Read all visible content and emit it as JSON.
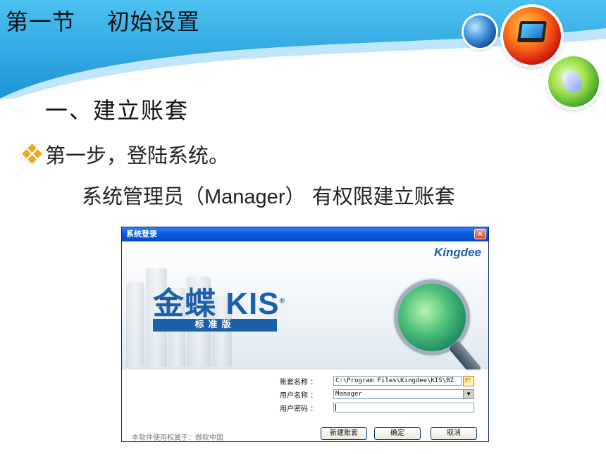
{
  "slide": {
    "title": "第一节    初始设置",
    "heading": "一、建立账套",
    "bullet": "第一步，登陆系统。",
    "line_pre": "系统管理员（",
    "line_latin": "Manager",
    "line_post": "） 有权限建立账套",
    "accent_colors": {
      "header": "#29a3e0",
      "bullet": "#f2a81c"
    }
  },
  "dialog": {
    "title": "系统登录",
    "close_label": "✕",
    "brand": "Kingdee",
    "product": "金蝶 KIS",
    "product_mark": "®",
    "edition": "标准版",
    "fields": {
      "account_label": "账套名称 ：",
      "account_value": "C:\\Program Files\\Kingdee\\KIS\\BZ",
      "user_label": "用户名称 ：",
      "user_value": "Manager",
      "password_label": "用户密码 ："
    },
    "buttons": {
      "new_account": "新建账套",
      "ok": "确定",
      "cancel": "取消"
    },
    "footer": "本软件使用权属于：微软中国"
  }
}
